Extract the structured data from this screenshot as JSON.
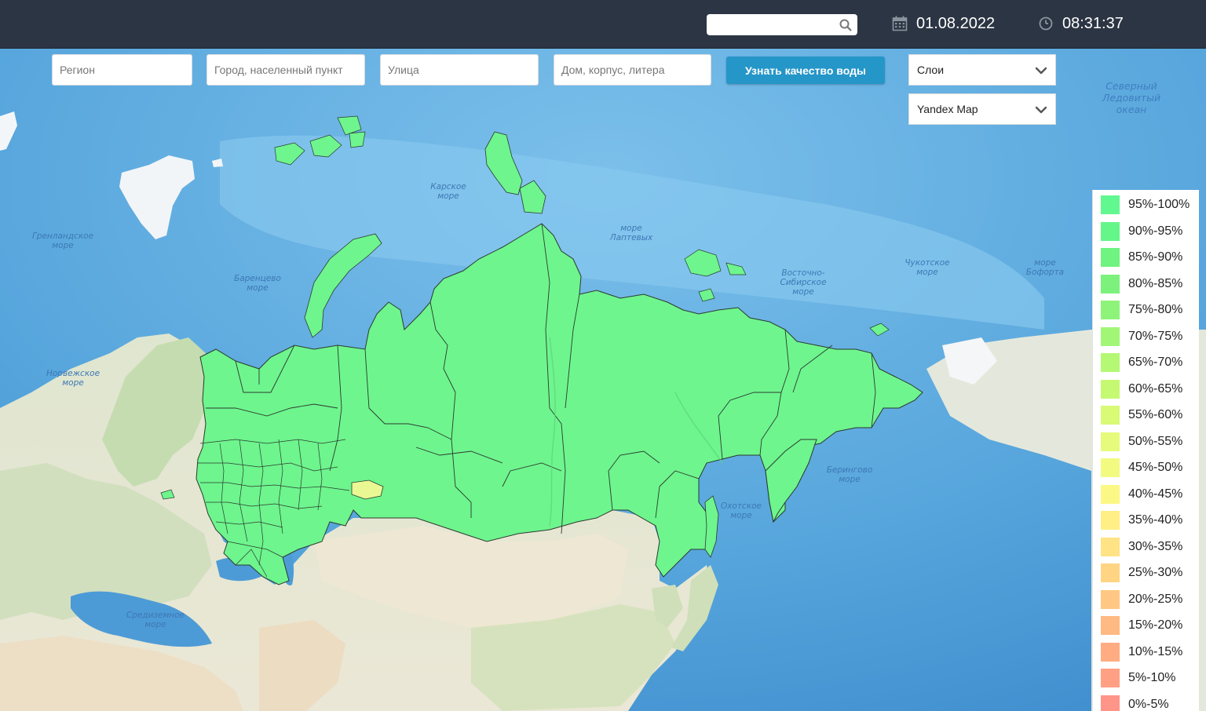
{
  "header": {
    "search_value": "",
    "date": "01.08.2022",
    "time": "08:31:37"
  },
  "address_form": {
    "region_placeholder": "Регион",
    "city_placeholder": "Город, населенный пункт",
    "street_placeholder": "Улица",
    "house_placeholder": "Дом, корпус, литера",
    "submit_label": "Узнать качество воды"
  },
  "layers": {
    "selected": "Слои"
  },
  "basemap": {
    "selected": "Yandex Map"
  },
  "legend": {
    "items": [
      {
        "label": "95%-100%",
        "color": "#62f890"
      },
      {
        "label": "90%-95%",
        "color": "#65f68a"
      },
      {
        "label": "85%-90%",
        "color": "#6ff381"
      },
      {
        "label": "80%-85%",
        "color": "#7cf27d"
      },
      {
        "label": "75%-80%",
        "color": "#8ef479"
      },
      {
        "label": "70%-75%",
        "color": "#a1f676"
      },
      {
        "label": "65%-70%",
        "color": "#b4f874"
      },
      {
        "label": "60%-65%",
        "color": "#c6f972"
      },
      {
        "label": "55%-60%",
        "color": "#d8fa75"
      },
      {
        "label": "50%-55%",
        "color": "#e6fb7b"
      },
      {
        "label": "45%-50%",
        "color": "#f2fb80"
      },
      {
        "label": "40%-45%",
        "color": "#fcf885"
      },
      {
        "label": "35%-40%",
        "color": "#ffef85"
      },
      {
        "label": "30%-35%",
        "color": "#ffe384"
      },
      {
        "label": "25%-30%",
        "color": "#ffd584"
      },
      {
        "label": "20%-25%",
        "color": "#ffc783"
      },
      {
        "label": "15%-20%",
        "color": "#ffb982"
      },
      {
        "label": "10%-15%",
        "color": "#ffac83"
      },
      {
        "label": "5%-10%",
        "color": "#ffa085"
      },
      {
        "label": "0%-5%",
        "color": "#ff9488"
      }
    ]
  },
  "map": {
    "sea_labels": {
      "northern_ocean": "Северный\nЛедовитый\nокеан",
      "kara_sea": "Карское\nморе",
      "laptev_sea": "море\nЛаптевых",
      "east_siberian_sea": "Восточно-\nСибирское\nморе",
      "chukchi_sea": "Чукотское\nморе",
      "beaufort_sea": "море\nБофорта",
      "greenland_sea": "Гренландское\nморе",
      "barents_sea": "Баренцево\nморе",
      "norwegian_sea": "Норвежское\nморе",
      "bering_sea": "Берингово\nморе",
      "okhotsk_sea": "Охотское\nморе",
      "mediterranean_sea": "Средиземное\nморе"
    },
    "colors": {
      "ocean": "#5aa7de",
      "ocean_deep": "#3f8fcf",
      "land": "#e8e9dd",
      "land_green": "#a9cf8c",
      "ice": "#f2f5f7",
      "russia_fill": "#6ef58e",
      "orenburg_fill": "#eaf893",
      "border": "#2b3a2d"
    }
  }
}
